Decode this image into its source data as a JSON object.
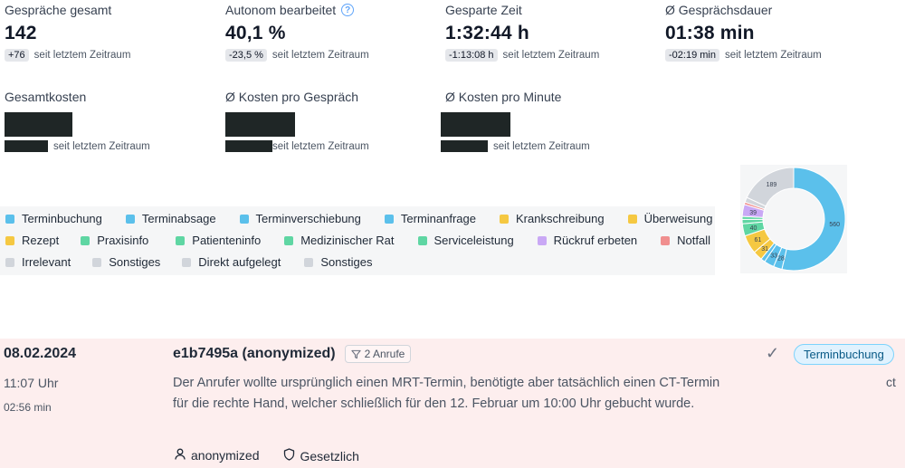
{
  "metrics": [
    {
      "label": "Gespräche gesamt",
      "value": "142",
      "delta": "+76",
      "suffix": "seit letztem Zeitraum",
      "info": false
    },
    {
      "label": "Autonom bearbeitet",
      "value": "40,1 %",
      "delta": "-23,5 %",
      "suffix": "seit letztem Zeitraum",
      "info": true
    },
    {
      "label": "Gesparte Zeit",
      "value": "1:32:44 h",
      "delta": "-1:13:08 h",
      "suffix": "seit letztem Zeitraum",
      "info": false
    },
    {
      "label": "Ø Gesprächsdauer",
      "value": "01:38 min",
      "delta": "-02:19 min",
      "suffix": "seit letztem Zeitraum",
      "info": false
    }
  ],
  "cost_metrics": [
    {
      "label": "Gesamtkosten",
      "suffix": "seit letztem Zeitraum"
    },
    {
      "label": "Ø Kosten pro Gespräch",
      "suffix": "seit letztem Zeitraum"
    },
    {
      "label": "Ø Kosten pro Minute",
      "suffix": "seit letztem Zeitraum"
    }
  ],
  "legend": [
    {
      "label": "Terminbuchung",
      "color": "#5bc0eb"
    },
    {
      "label": "Terminabsage",
      "color": "#5bc0eb"
    },
    {
      "label": "Terminverschiebung",
      "color": "#5bc0eb"
    },
    {
      "label": "Terminanfrage",
      "color": "#5bc0eb"
    },
    {
      "label": "Krankschreibung",
      "color": "#f5c842"
    },
    {
      "label": "Überweisung",
      "color": "#f5c842"
    },
    {
      "label": "Rezept",
      "color": "#f5c842"
    },
    {
      "label": "Praxisinfo",
      "color": "#5fd6a3"
    },
    {
      "label": "Patienteninfo",
      "color": "#5fd6a3"
    },
    {
      "label": "Medizinischer Rat",
      "color": "#5fd6a3"
    },
    {
      "label": "Serviceleistung",
      "color": "#5fd6a3"
    },
    {
      "label": "Rückruf erbeten",
      "color": "#c9a8f5"
    },
    {
      "label": "Notfall",
      "color": "#f08f8f"
    },
    {
      "label": "Irrelevant",
      "color": "#d1d5db"
    },
    {
      "label": "Sonstiges",
      "color": "#d1d5db"
    },
    {
      "label": "Direkt aufgelegt",
      "color": "#d1d5db"
    },
    {
      "label": "Sonstiges",
      "color": "#d1d5db"
    }
  ],
  "chart_data": {
    "type": "pie",
    "series": [
      {
        "label": "560",
        "value": 560,
        "color": "#5bc0eb"
      },
      {
        "label": "28",
        "value": 28,
        "color": "#5bc0eb"
      },
      {
        "label": "33",
        "value": 33,
        "color": "#5bc0eb"
      },
      {
        "label": "",
        "value": 14,
        "color": "#5bc0eb"
      },
      {
        "label": "31",
        "value": 31,
        "color": "#f5c842"
      },
      {
        "label": "61",
        "value": 61,
        "color": "#f5c842"
      },
      {
        "label": "40",
        "value": 40,
        "color": "#5fd6a3"
      },
      {
        "label": "",
        "value": 14,
        "color": "#5fd6a3"
      },
      {
        "label": "",
        "value": 10,
        "color": "#5fd6a3"
      },
      {
        "label": "39",
        "value": 39,
        "color": "#c9a8f5"
      },
      {
        "label": "",
        "value": 8,
        "color": "#f08f8f"
      },
      {
        "label": "",
        "value": 16,
        "color": "#d1d5db"
      },
      {
        "label": "189",
        "value": 189,
        "color": "#d1d5db"
      }
    ]
  },
  "call": {
    "date": "08.02.2024",
    "time": "11:07 Uhr",
    "duration": "02:56 min",
    "id": "e1b7495a (anonymized)",
    "calls": "2 Anrufe",
    "summary": "Der Anrufer wollte ursprünglich einen MRT-Termin, benötigte aber tatsächlich einen CT-Termin für die rechte Hand, welcher schließlich für den 12. Februar um 10:00 Uhr gebucht wurde.",
    "caller": "anonymized",
    "insurance": "Gesetzlich",
    "tag": "Terminbuchung",
    "side_text": "ct"
  }
}
